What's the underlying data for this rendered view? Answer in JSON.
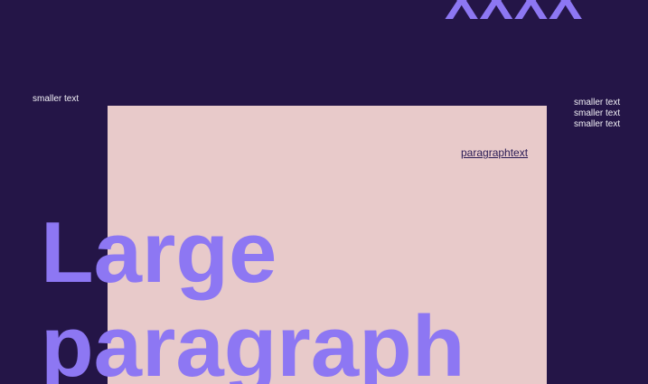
{
  "top_mark": "XXXX",
  "left_caption": "smaller text",
  "right_captions": [
    "smaller text",
    "smaller text",
    "smaller text"
  ],
  "paragraph_link": "paragraphtext",
  "headline": {
    "line1": "Large",
    "line2": "paragraph"
  },
  "colors": {
    "background": "#241547",
    "panel": "#E8CACA",
    "accent": "#8D77F3",
    "caption": "#F2F0F6",
    "link": "#2A1B55"
  }
}
